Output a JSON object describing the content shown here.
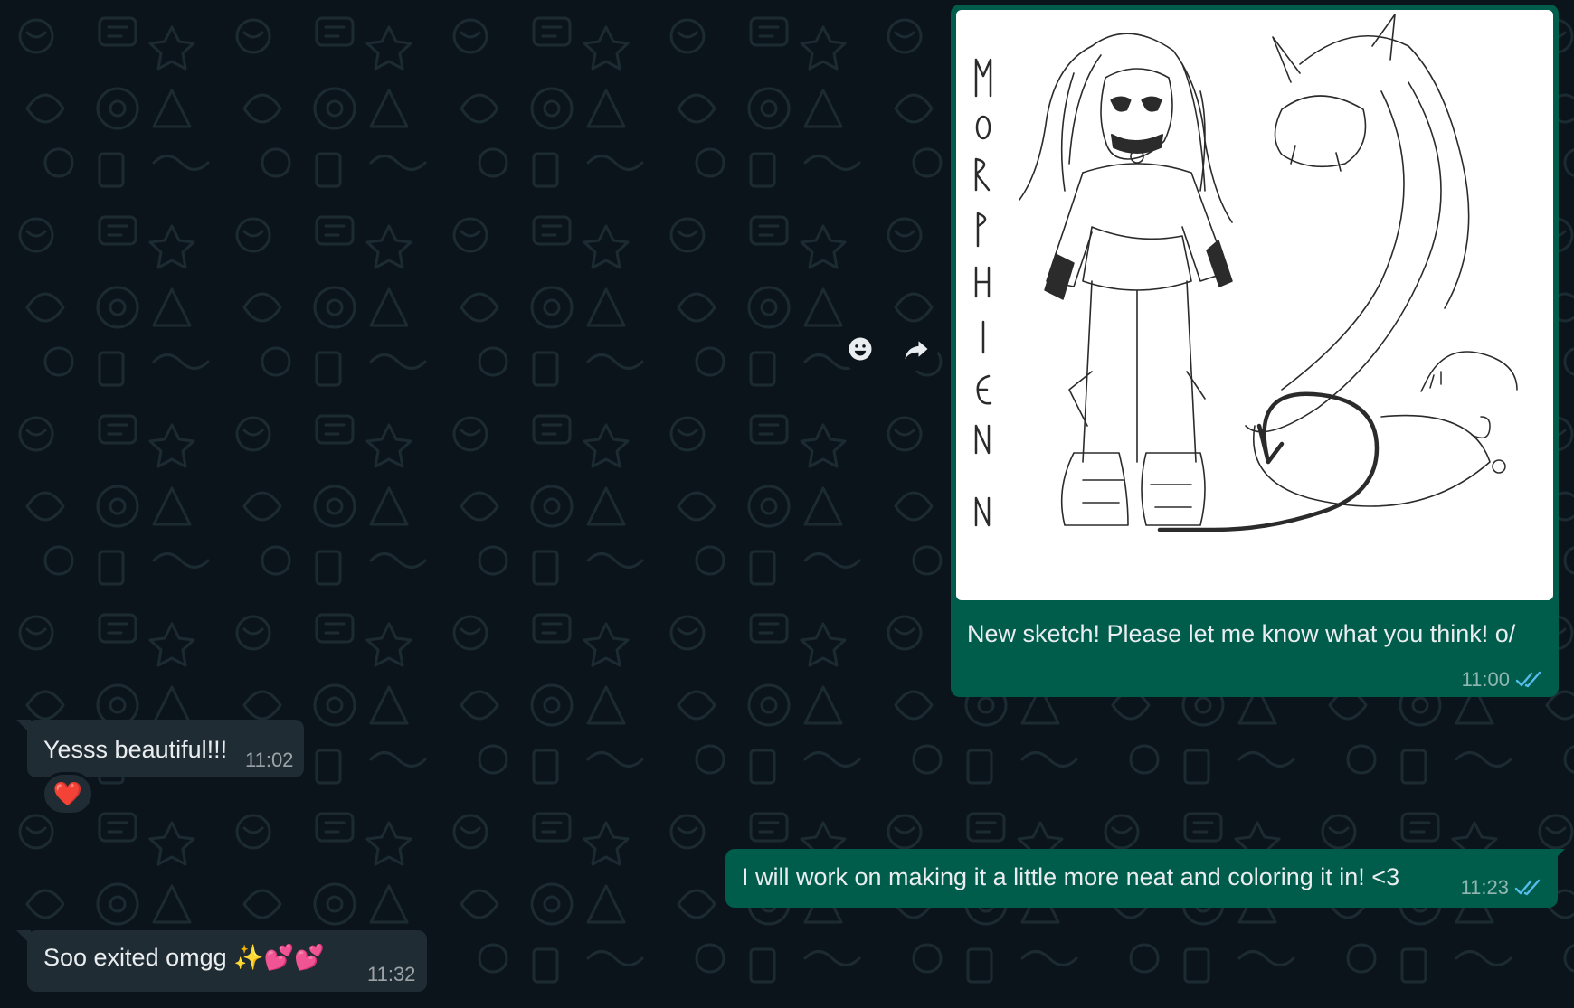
{
  "messages": {
    "image_post": {
      "caption": "New sketch! Please let me know what you think! o/",
      "time": "11:00",
      "sketch_lettering": "MORPHIENN"
    },
    "reply_1": {
      "text": "Yesss beautiful!!!",
      "time": "11:02",
      "reaction": "❤️"
    },
    "reply_2": {
      "text": "I will work on making it a little more neat and coloring it in! <3",
      "time": "11:23"
    },
    "reply_3": {
      "text": "Soo exited omgg ✨💕💕",
      "time": "11:32"
    }
  },
  "icons": {
    "emoji": "smiley-icon",
    "forward": "forward-arrow-icon",
    "read": "double-check-icon"
  },
  "colors": {
    "background": "#0b141a",
    "outgoing_bubble": "#005c4b",
    "incoming_bubble": "#202c33",
    "read_ticks": "#53bdeb"
  }
}
